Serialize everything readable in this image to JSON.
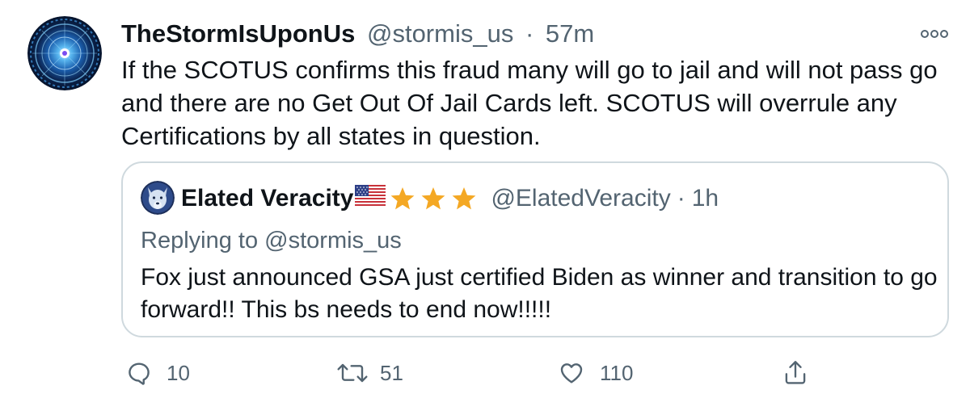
{
  "tweet": {
    "display_name": "TheStormIsUponUs",
    "handle": "@stormis_us",
    "separator": "·",
    "time": "57m",
    "text": "If the SCOTUS confirms this fraud many will go to jail and will not pass go and there are no Get Out Of Jail Cards left. SCOTUS will overrule any Certifications by all states in question.",
    "avatar_icon": "cosmic-vortex-avatar",
    "more_icon": "more-options-icon"
  },
  "quote": {
    "display_name": "Elated Veracity",
    "flag_icon": "us-flag-icon",
    "star_icon": "star-icon",
    "star_count": 3,
    "handle": "@ElatedVeracity",
    "separator": "·",
    "time": "1h",
    "replying_prefix": "Replying to",
    "replying_handle": "@stormis_us",
    "text": "Fox just announced GSA just certified Biden as winner and transition to go forward!!  This bs needs to end now!!!!!",
    "avatar_icon": "wolf-avatar"
  },
  "actions": {
    "reply_count": "10",
    "retweet_count": "51",
    "like_count": "110",
    "reply_icon": "reply-icon",
    "retweet_icon": "retweet-icon",
    "like_icon": "heart-icon",
    "share_icon": "share-icon"
  },
  "colors": {
    "text": "#0f1419",
    "muted": "#536471",
    "border": "#cfd9de",
    "star": "#f4a824"
  }
}
